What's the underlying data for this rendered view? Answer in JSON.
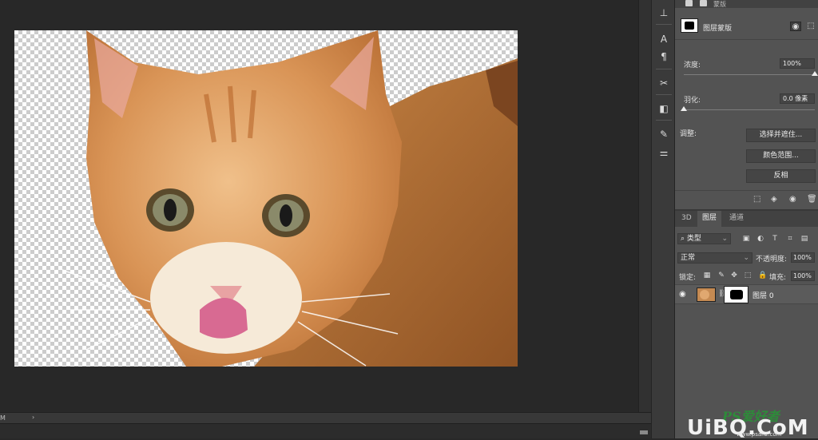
{
  "properties": {
    "tab_label": "蒙版",
    "mask_name": "图层蒙版",
    "density_label": "浓度:",
    "density_value": "100%",
    "density_level": 1.0,
    "feather_label": "羽化:",
    "feather_value": "0.0 像素",
    "feather_level": 0.0,
    "adjust_label": "调整:",
    "buttons": [
      "选择并遮住...",
      "颜色范围...",
      "反相"
    ]
  },
  "layers_panel": {
    "tabs": [
      "3D",
      "图层",
      "通道"
    ],
    "active_tab": "图层",
    "filter_kind": "类型",
    "blend_mode": "正常",
    "opacity_label": "不透明度:",
    "opacity_value": "100%",
    "lock_label": "锁定:",
    "fill_label": "填充:",
    "fill_value": "100%",
    "layer_name": "图层 0"
  },
  "status": {
    "zoom": "M",
    "arrow": "›"
  },
  "watermark": {
    "top": "PS爱好者",
    "main": "UiBQ.CoM",
    "url": "www.psahz.com"
  },
  "colors": {
    "accent_green": "#2e8b3a",
    "panel_bg": "#535353",
    "canvas_bg": "#282828"
  }
}
